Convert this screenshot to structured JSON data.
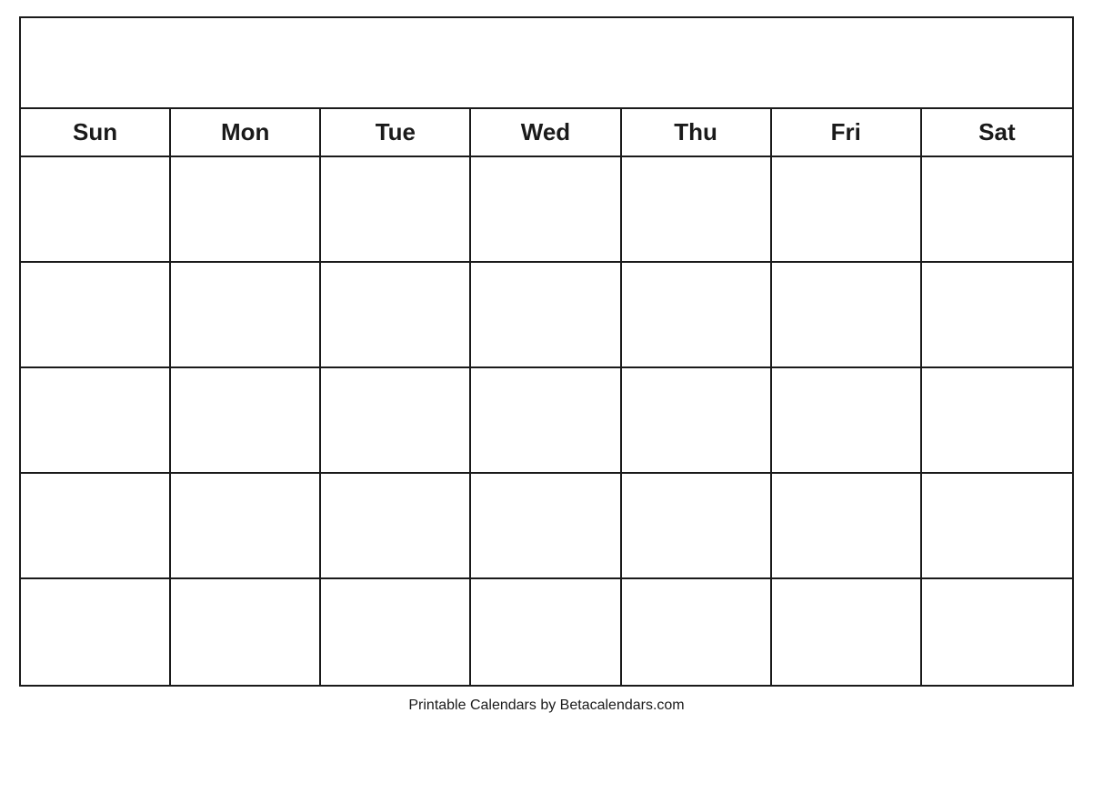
{
  "calendar": {
    "title": "",
    "days": [
      "Sun",
      "Mon",
      "Tue",
      "Wed",
      "Thu",
      "Fri",
      "Sat"
    ],
    "weeks": [
      [
        "",
        "",
        "",
        "",
        "",
        "",
        ""
      ],
      [
        "",
        "",
        "",
        "",
        "",
        "",
        ""
      ],
      [
        "",
        "",
        "",
        "",
        "",
        "",
        ""
      ],
      [
        "",
        "",
        "",
        "",
        "",
        "",
        ""
      ],
      [
        "",
        "",
        "",
        "",
        "",
        "",
        ""
      ]
    ]
  },
  "footer": {
    "text": "Printable Calendars by Betacalendars.com"
  }
}
